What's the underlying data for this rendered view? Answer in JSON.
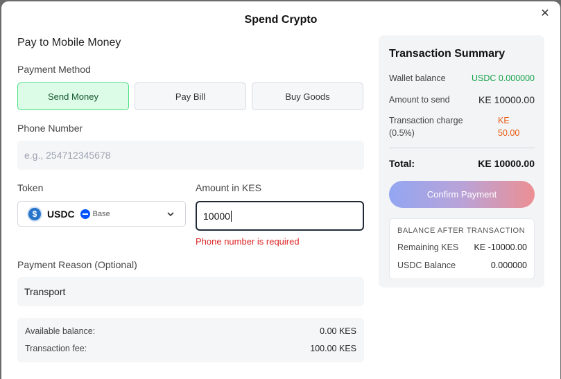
{
  "modal": {
    "title": "Spend Crypto",
    "close_icon": "close-icon"
  },
  "form": {
    "section_title": "Pay to Mobile Money",
    "payment_method_label": "Payment Method",
    "methods": [
      {
        "label": "Send Money",
        "active": true
      },
      {
        "label": "Pay Bill",
        "active": false
      },
      {
        "label": "Buy Goods",
        "active": false
      }
    ],
    "phone_label": "Phone Number",
    "phone_placeholder": "e.g., 254712345678",
    "phone_value": "",
    "token_label": "Token",
    "token": {
      "symbol": "USDC",
      "logo_char": "$",
      "network": "Base"
    },
    "amount_label": "Amount in KES",
    "amount_value": "10000",
    "amount_error": "Phone number is required",
    "reason_label": "Payment Reason (Optional)",
    "reason_value": "Transport",
    "available_balance_label": "Available balance:",
    "available_balance_value": "0.00 KES",
    "transaction_fee_label": "Transaction fee:",
    "transaction_fee_value": "100.00 KES"
  },
  "summary": {
    "title": "Transaction Summary",
    "wallet_balance_label": "Wallet balance",
    "wallet_balance_value": "USDC 0.000000",
    "amount_to_send_label": "Amount to send",
    "amount_to_send_value": "KE 10000.00",
    "transaction_charge_label_1": "Transaction charge",
    "transaction_charge_label_2": "(0.5%)",
    "transaction_charge_value_1": "KE",
    "transaction_charge_value_2": "50.00",
    "total_label": "Total:",
    "total_value": "KE 10000.00",
    "confirm_label": "Confirm Payment",
    "after": {
      "title": "BALANCE AFTER TRANSACTION",
      "remaining_label": "Remaining KES",
      "remaining_value": "KE -10000.00",
      "usdc_label": "USDC Balance",
      "usdc_value": "0.000000"
    }
  },
  "colors": {
    "accent_green": "#16a34a",
    "active_method_bg": "#dcfce7",
    "error_red": "#dc2626",
    "charge_orange": "#ea580c"
  }
}
